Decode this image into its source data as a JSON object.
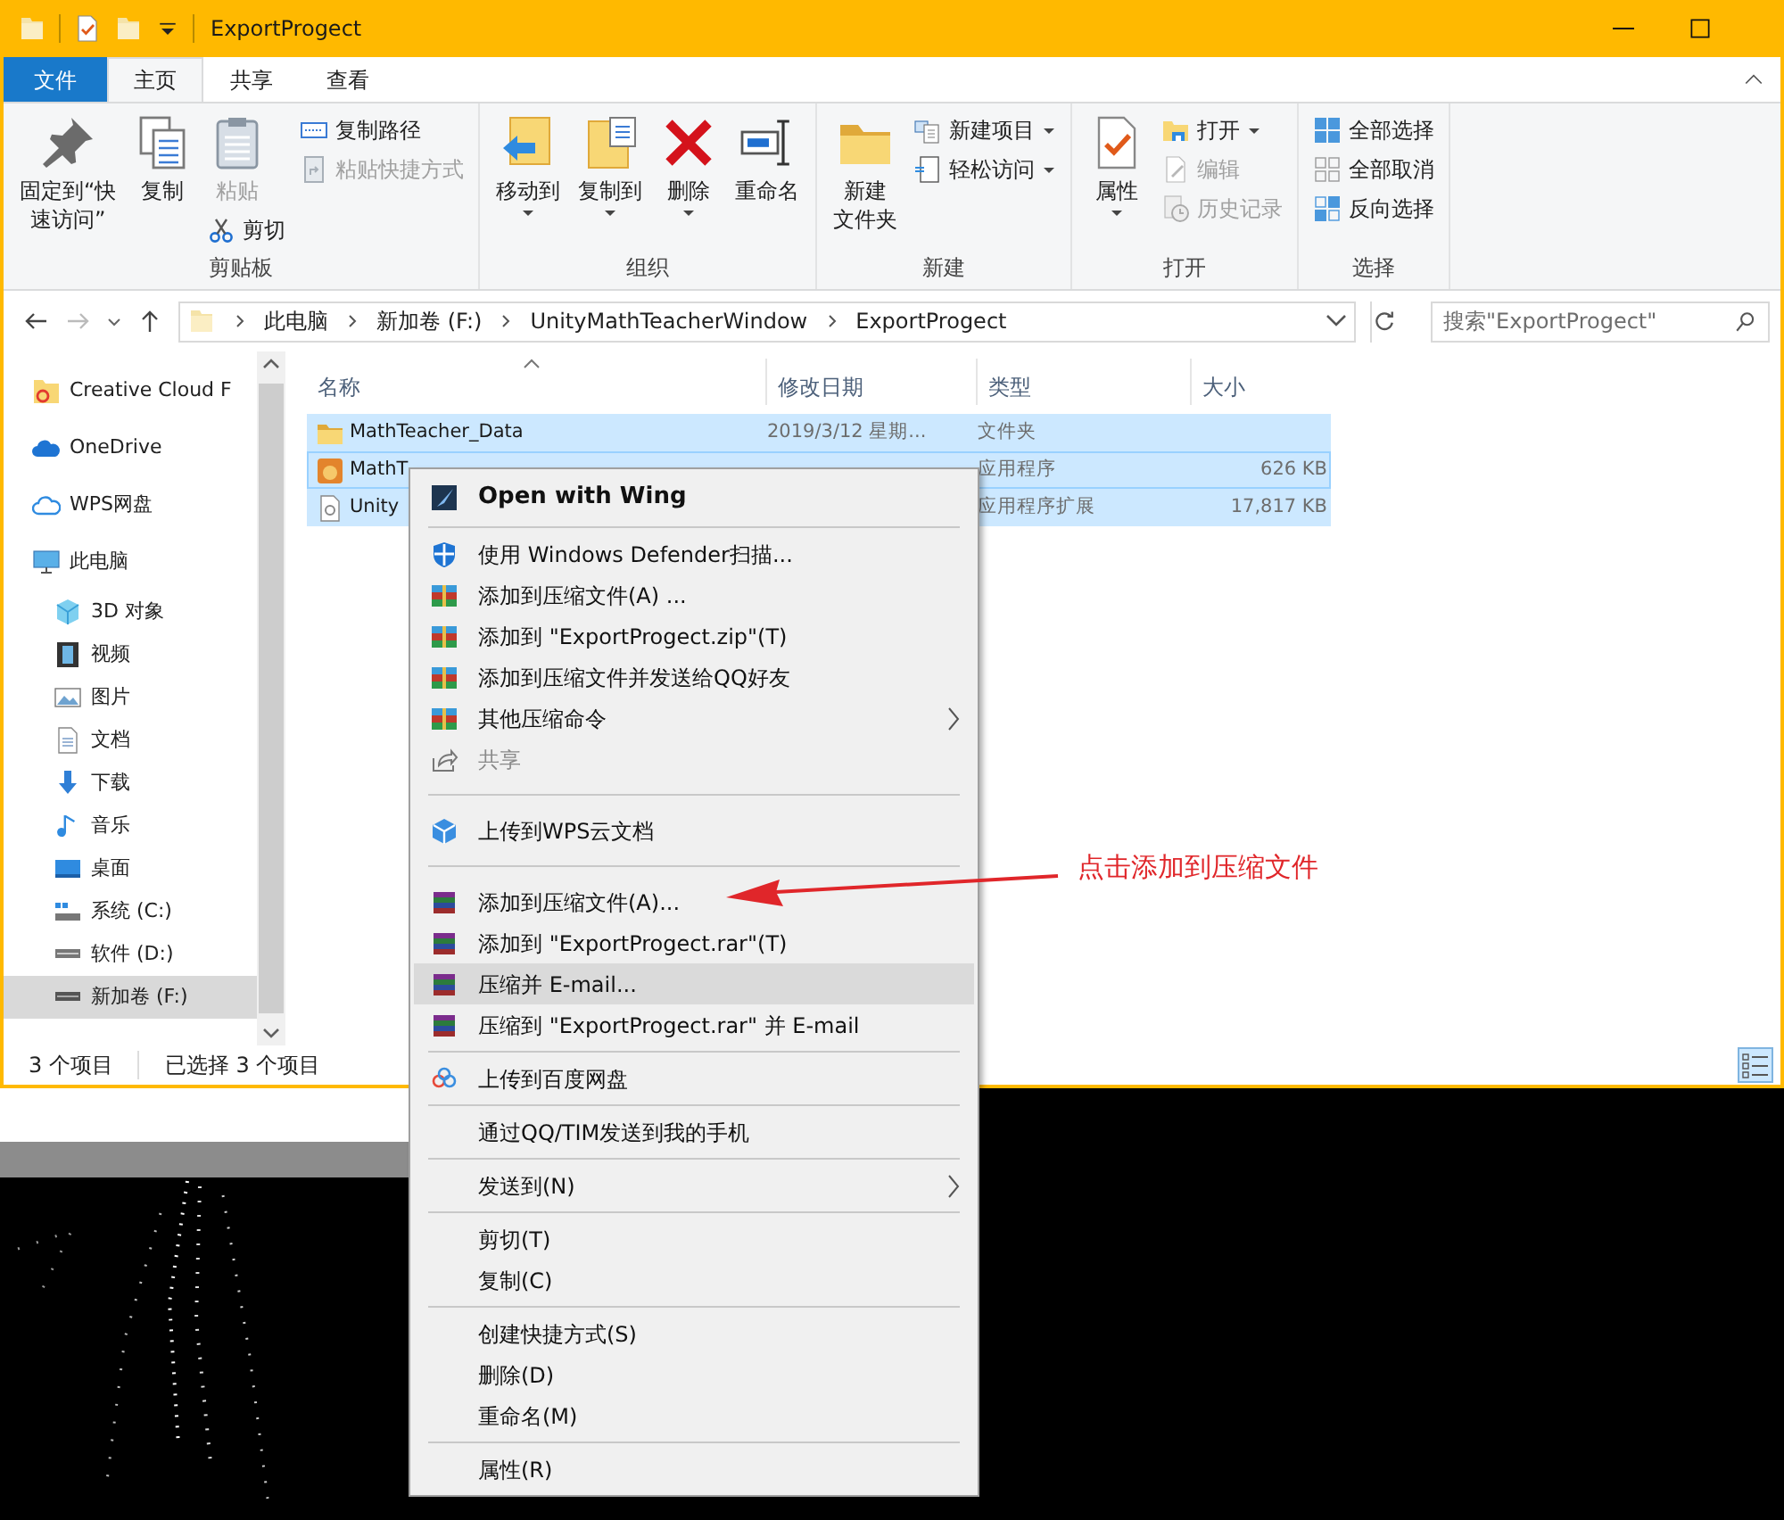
{
  "window": {
    "title": "ExportProgect"
  },
  "ribbon_tabs": [
    {
      "label": "文件",
      "kind": "file",
      "selected": false
    },
    {
      "label": "主页",
      "kind": "tab",
      "selected": true
    },
    {
      "label": "共享",
      "kind": "tab",
      "selected": false
    },
    {
      "label": "查看",
      "kind": "tab",
      "selected": false
    }
  ],
  "ribbon_groups": [
    {
      "label": "剪贴板",
      "columns": [
        [
          {
            "lines": [
              "固定到“快",
              "速访问”"
            ],
            "kind": "large",
            "disabled": false,
            "dropdown": false
          }
        ],
        [
          {
            "lines": [
              "复制"
            ],
            "kind": "large",
            "disabled": false,
            "dropdown": false
          }
        ],
        [
          {
            "lines": [
              "粘贴"
            ],
            "kind": "large",
            "disabled": true,
            "dropdown": false
          },
          {
            "lines": [
              "剪切"
            ],
            "kind": "small",
            "disabled": false,
            "dropdown": false
          }
        ],
        [
          {
            "lines": [
              "复制路径"
            ],
            "kind": "small",
            "disabled": false,
            "dropdown": false
          },
          {
            "lines": [
              "粘贴快捷方式"
            ],
            "kind": "small",
            "disabled": true,
            "dropdown": false
          }
        ]
      ]
    },
    {
      "label": "组织",
      "columns": [
        [
          {
            "lines": [
              "移动到"
            ],
            "kind": "large",
            "disabled": false,
            "dropdown": true
          }
        ],
        [
          {
            "lines": [
              "复制到"
            ],
            "kind": "large",
            "disabled": false,
            "dropdown": true
          }
        ],
        [
          {
            "lines": [
              "删除"
            ],
            "kind": "large",
            "disabled": false,
            "dropdown": true
          }
        ],
        [
          {
            "lines": [
              "重命名"
            ],
            "kind": "large",
            "disabled": false,
            "dropdown": false
          }
        ]
      ]
    },
    {
      "label": "新建",
      "columns": [
        [
          {
            "lines": [
              "新建",
              "文件夹"
            ],
            "kind": "large",
            "disabled": false,
            "dropdown": false
          }
        ],
        [
          {
            "lines": [
              "新建项目"
            ],
            "kind": "small",
            "disabled": false,
            "dropdown": true
          },
          {
            "lines": [
              "轻松访问"
            ],
            "kind": "small",
            "disabled": false,
            "dropdown": true
          }
        ]
      ]
    },
    {
      "label": "打开",
      "columns": [
        [
          {
            "lines": [
              "属性"
            ],
            "kind": "large",
            "disabled": false,
            "dropdown": true
          }
        ],
        [
          {
            "lines": [
              "打开"
            ],
            "kind": "small",
            "disabled": false,
            "dropdown": true
          },
          {
            "lines": [
              "编辑"
            ],
            "kind": "small",
            "disabled": true,
            "dropdown": false
          },
          {
            "lines": [
              "历史记录"
            ],
            "kind": "small",
            "disabled": true,
            "dropdown": false
          }
        ]
      ]
    },
    {
      "label": "选择",
      "columns": [
        [
          {
            "lines": [
              "全部选择"
            ],
            "kind": "small",
            "disabled": false,
            "dropdown": false
          },
          {
            "lines": [
              "全部取消"
            ],
            "kind": "small",
            "disabled": false,
            "dropdown": false
          },
          {
            "lines": [
              "反向选择"
            ],
            "kind": "small",
            "disabled": false,
            "dropdown": false
          }
        ]
      ]
    }
  ],
  "address": {
    "path": [
      "此电脑",
      "新加卷 (F:)",
      "UnityMathTeacherWindow",
      "ExportProgect"
    ]
  },
  "search": {
    "placeholder": "搜索\"ExportProgect\""
  },
  "sidebar": {
    "items": [
      {
        "label": "Creative Cloud F",
        "selected": false
      },
      {
        "label": "OneDrive",
        "selected": false
      },
      {
        "label": "WPS网盘",
        "selected": false
      },
      {
        "label": "此电脑",
        "selected": false,
        "children": [
          {
            "label": "3D 对象",
            "selected": false
          },
          {
            "label": "视频",
            "selected": false
          },
          {
            "label": "图片",
            "selected": false
          },
          {
            "label": "文档",
            "selected": false
          },
          {
            "label": "下载",
            "selected": false
          },
          {
            "label": "音乐",
            "selected": false
          },
          {
            "label": "桌面",
            "selected": false
          },
          {
            "label": "系统 (C:)",
            "selected": false
          },
          {
            "label": "软件 (D:)",
            "selected": false
          },
          {
            "label": "新加卷 (F:)",
            "selected": true
          }
        ]
      }
    ]
  },
  "table": {
    "columns": [
      {
        "label": "名称",
        "sorted": true
      },
      {
        "label": "修改日期",
        "sorted": false
      },
      {
        "label": "类型",
        "sorted": false
      },
      {
        "label": "大小",
        "sorted": false
      }
    ],
    "rows": [
      {
        "name": "MathTeacher_Data",
        "modified": "2019/3/12 星期...",
        "type": "文件夹",
        "selected": true,
        "focused": false
      },
      {
        "name": "MathT",
        "type": "应用程序",
        "size": "626 KB",
        "selected": true,
        "focused": true
      },
      {
        "name": "Unity",
        "type": "应用程序扩展",
        "size": "17,817 KB",
        "selected": true,
        "focused": false
      }
    ]
  },
  "status_bar": [
    "3 个项目",
    "已选择 3 个项目"
  ],
  "context_menu": {
    "sections": [
      [
        {
          "label": "Open with Wing",
          "bold": true,
          "disabled": false,
          "submenu": false,
          "selected": false
        }
      ],
      [
        {
          "label": "使用 Windows Defender扫描...",
          "bold": false,
          "disabled": false,
          "submenu": false,
          "selected": false
        },
        {
          "label": "添加到压缩文件(A) ...",
          "bold": false,
          "disabled": false,
          "submenu": false,
          "selected": false
        },
        {
          "label": "添加到 \"ExportProgect.zip\"(T)",
          "bold": false,
          "disabled": false,
          "submenu": false,
          "selected": false
        },
        {
          "label": "添加到压缩文件并发送给QQ好友",
          "bold": false,
          "disabled": false,
          "submenu": false,
          "selected": false
        },
        {
          "label": "其他压缩命令",
          "bold": false,
          "disabled": false,
          "submenu": true,
          "selected": false
        },
        {
          "label": "共享",
          "bold": false,
          "disabled": true,
          "submenu": false,
          "selected": false
        }
      ],
      [
        {
          "label": "上传到WPS云文档",
          "bold": false,
          "disabled": false,
          "submenu": false,
          "selected": false
        }
      ],
      [
        {
          "label": "添加到压缩文件(A)...",
          "bold": false,
          "disabled": false,
          "submenu": false,
          "selected": false
        },
        {
          "label": "添加到 \"ExportProgect.rar\"(T)",
          "bold": false,
          "disabled": false,
          "submenu": false,
          "selected": false
        },
        {
          "label": "压缩并 E-mail...",
          "bold": false,
          "disabled": false,
          "submenu": false,
          "selected": true
        },
        {
          "label": "压缩到 \"ExportProgect.rar\" 并 E-mail",
          "bold": false,
          "disabled": false,
          "submenu": false,
          "selected": false
        }
      ],
      [
        {
          "label": "上传到百度网盘",
          "bold": false,
          "disabled": false,
          "submenu": false,
          "selected": false
        }
      ],
      [
        {
          "label": "通过QQ/TIM发送到我的手机",
          "bold": false,
          "disabled": false,
          "submenu": false,
          "selected": false
        }
      ],
      [
        {
          "label": "发送到(N)",
          "bold": false,
          "disabled": false,
          "submenu": true,
          "selected": false
        }
      ],
      [
        {
          "label": "剪切(T)",
          "bold": false,
          "disabled": false,
          "submenu": false,
          "selected": false
        },
        {
          "label": "复制(C)",
          "bold": false,
          "disabled": false,
          "submenu": false,
          "selected": false
        }
      ],
      [
        {
          "label": "创建快捷方式(S)",
          "bold": false,
          "disabled": false,
          "submenu": false,
          "selected": false
        },
        {
          "label": "删除(D)",
          "bold": false,
          "disabled": false,
          "submenu": false,
          "selected": false
        },
        {
          "label": "重命名(M)",
          "bold": false,
          "disabled": false,
          "submenu": false,
          "selected": false
        }
      ],
      [
        {
          "label": "属性(R)",
          "bold": false,
          "disabled": false,
          "submenu": false,
          "selected": false
        }
      ]
    ]
  },
  "annotation": {
    "text": "点击添加到压缩文件"
  }
}
